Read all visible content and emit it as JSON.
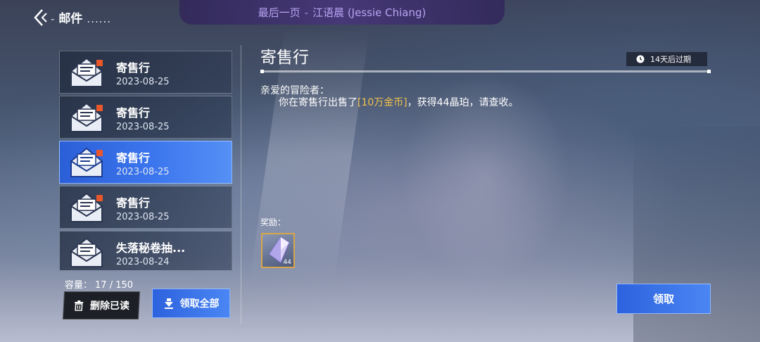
{
  "header": {
    "dash": "-",
    "title": "邮件",
    "dots": "......"
  },
  "banner": {
    "prefix": "最后一页",
    "separator": "-",
    "name": "江语晨 (Jessie Chiang)"
  },
  "mail_list": [
    {
      "title": "寄售行",
      "date": "2023-08-25",
      "selected": false
    },
    {
      "title": "寄售行",
      "date": "2023-08-25",
      "selected": false
    },
    {
      "title": "寄售行",
      "date": "2023-08-25",
      "selected": true
    },
    {
      "title": "寄售行",
      "date": "2023-08-25",
      "selected": false
    },
    {
      "title": "失落秘卷抽...",
      "date": "2023-08-24",
      "selected": false
    }
  ],
  "capacity": {
    "label": "容量：",
    "value": "17 / 150"
  },
  "buttons": {
    "delete_read": "删除已读",
    "claim_all": "领取全部",
    "claim": "领取"
  },
  "detail": {
    "title": "寄售行",
    "expiry": "14天后过期",
    "greeting": "亲爱的冒险者：",
    "message_before": "你在寄售行出售了",
    "message_highlight": "[10万金币]",
    "message_after": "，获得44晶珀，请查收。",
    "reward_label": "奖励：",
    "reward_qty": "44"
  },
  "icons": {
    "back": "back-arrow-icon",
    "mail": "envelope-icon",
    "clock": "clock-icon",
    "trash": "trash-icon",
    "download": "download-arrow-icon",
    "crystal": "crystal-icon"
  },
  "colors": {
    "selected_mail": "#3c76ee",
    "button_blue": "#2d62de",
    "highlight_gold": "#f0c34e",
    "banner_text": "#b7a3f2"
  }
}
